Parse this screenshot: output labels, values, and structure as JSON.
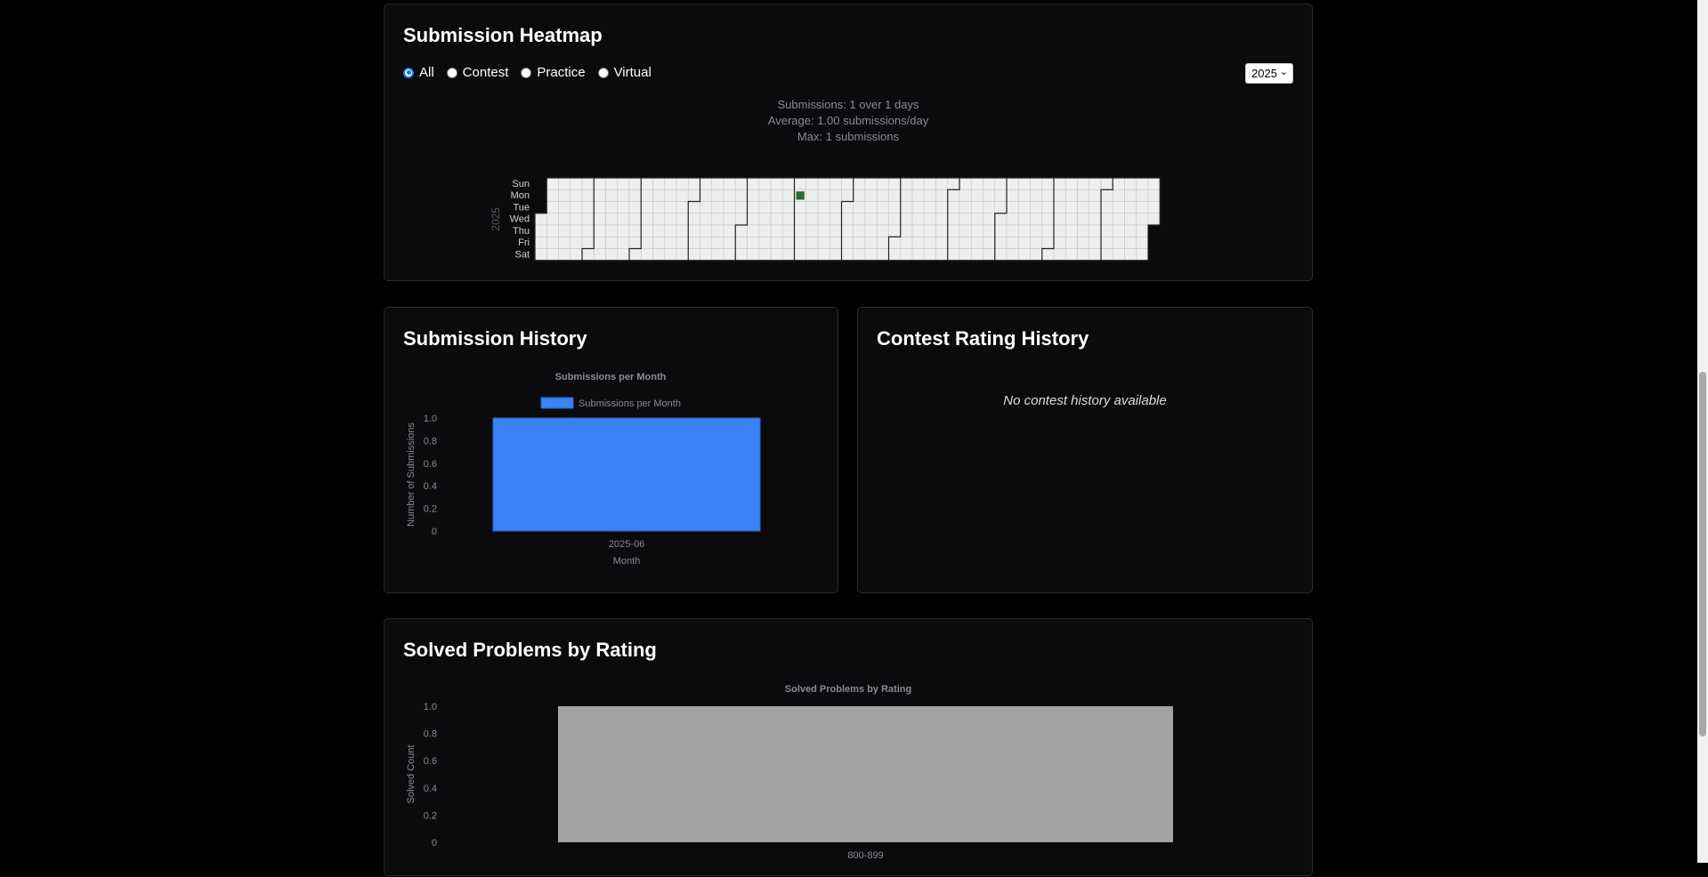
{
  "heatmap": {
    "title": "Submission Heatmap",
    "filters": [
      {
        "label": "All",
        "checked": true
      },
      {
        "label": "Contest",
        "checked": false
      },
      {
        "label": "Practice",
        "checked": false
      },
      {
        "label": "Virtual",
        "checked": false
      }
    ],
    "year_selected": "2025",
    "stats": {
      "line1": "Submissions: 1 over 1 days",
      "line2": "Average: 1.00 submissions/day",
      "line3": "Max: 1 submissions"
    },
    "year_label": "2025",
    "day_labels": [
      "Sun",
      "Mon",
      "Tue",
      "Wed",
      "Thu",
      "Fri",
      "Sat"
    ],
    "active_cell": {
      "date": "2025-06-02",
      "count": 1
    },
    "colors": {
      "empty": "#eeeeee",
      "active": "#216e39"
    }
  },
  "submission_history": {
    "title": "Submission History",
    "chart_data": {
      "type": "bar",
      "title": "Submissions per Month",
      "categories": [
        "2025-06"
      ],
      "series": [
        {
          "name": "Submissions per Month",
          "values": [
            1
          ],
          "color": "#3b82f6"
        }
      ],
      "xlabel": "Month",
      "ylabel": "Number of Submissions",
      "ylim": [
        0,
        1
      ],
      "yticks": [
        "0",
        "0.2",
        "0.4",
        "0.6",
        "0.8",
        "1.0"
      ],
      "legend": "top"
    }
  },
  "contest_history": {
    "title": "Contest Rating History",
    "empty_message": "No contest history available"
  },
  "solved_by_rating": {
    "title": "Solved Problems by Rating",
    "chart_data": {
      "type": "bar",
      "title": "Solved Problems by Rating",
      "categories": [
        "800-899"
      ],
      "series": [
        {
          "values": [
            1
          ],
          "color": "#a3a3a3"
        }
      ],
      "ylabel": "Solved Count",
      "ylim": [
        0,
        1
      ],
      "yticks": [
        "0",
        "0.2",
        "0.4",
        "0.6",
        "0.8",
        "1.0"
      ]
    }
  }
}
